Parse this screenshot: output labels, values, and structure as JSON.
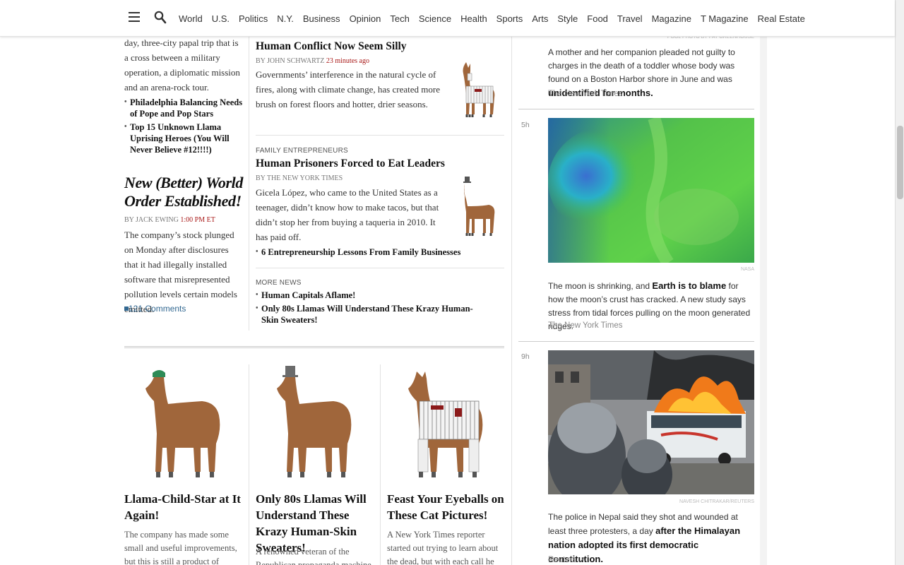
{
  "nav": {
    "items": [
      "World",
      "U.S.",
      "Politics",
      "N.Y.",
      "Business",
      "Opinion",
      "Tech",
      "Science",
      "Health",
      "Sports",
      "Arts",
      "Style",
      "Food",
      "Travel",
      "Magazine",
      "T Magazine",
      "Real Estate"
    ]
  },
  "left_column": {
    "lead_summary": "day, three-city papal trip that is a cross between a military operation, a diplomatic mission and an arena-rock tour.",
    "lead_related": [
      "Philadelphia Balancing Needs of Pope and Pop Stars",
      "Top 15 Unknown Llama Uprising Heroes (You Will Never Believe #12!!!!)"
    ],
    "story2": {
      "headline": "New (Better) World Order Established!",
      "byline": "By JACK EWING",
      "time": "1:00 PM ET",
      "summary": "The company’s stock plunged on Monday after disclosures that it had illegally installed software that misrepresented pollution levels certain models emitted.",
      "comments": "121 Comments"
    }
  },
  "middle_column": {
    "story1": {
      "headline": "Human Conflict Now Seem Silly",
      "byline": "By JOHN SCHWARTZ",
      "time": "23 minutes ago",
      "summary": "Governments’ interference in the natural cycle of fires, along with climate change, has created more brush on forest floors and hotter, drier seasons."
    },
    "story2": {
      "kicker": "FAMILY ENTREPRENEURS",
      "headline": "Human Prisoners Forced to Eat Leaders",
      "byline": "By THE NEW YORK TIMES",
      "summary": "Gicela López, who came to the United States as a teenager, didn’t know how to make tacos, but that didn’t stop her from buying a taqueria in 2010. It has paid off.",
      "related": [
        "6 Entrepreneurship Lessons From Family Businesses"
      ]
    },
    "more_news": {
      "kicker": "MORE NEWS",
      "items": [
        "Human Capitals Aflame!",
        "Only 80s Llamas Will Understand These Krazy Human-Skin Sweaters!"
      ]
    }
  },
  "bottom_row": [
    {
      "headline": "Llama-Child-Star at It Again!",
      "summary": "The company has made some small and useful improvements, but this is still a product of"
    },
    {
      "headline": "Only 80s Llamas Will Understand These Krazy Human-Skin Sweaters!",
      "summary": "A renowned veteran of the Republican propaganda machine"
    },
    {
      "headline": "Feast Your Eyeballs on These Cat Pictures!",
      "summary": "A New York Times reporter started out trying to learn about the dead, but with each call he"
    }
  ],
  "right_column": {
    "item1": {
      "credit": "POOL PHOTO BY PAT GREENHOUSE",
      "text_pre": "A mother and her companion pleaded not guilty to charges in the death of a toddler whose body was found on a Boston Harbor shore in June and was ",
      "text_bold": "unidentified for months.",
      "source": "The New York Times"
    },
    "item2": {
      "time": "5h",
      "credit": "NASA",
      "text_pre": "The moon is shrinking, and ",
      "text_bold": "Earth is to blame",
      "text_post": " for how the moon’s crust has cracked. A new study says stress from tidal forces pulling on the moon generated ridges.",
      "source": "The New York Times"
    },
    "item3": {
      "time": "9h",
      "credit": "NAVESH CHITRAKAR/REUTERS",
      "text_pre": "The police in Nepal said they shot and wounded at least three protesters, a day ",
      "text_bold": "after the Himalayan nation adopted its first democratic constitution.",
      "source": "Reuters ↗"
    }
  },
  "colors": {
    "accent_time": "#a81817",
    "link": "#326891"
  }
}
